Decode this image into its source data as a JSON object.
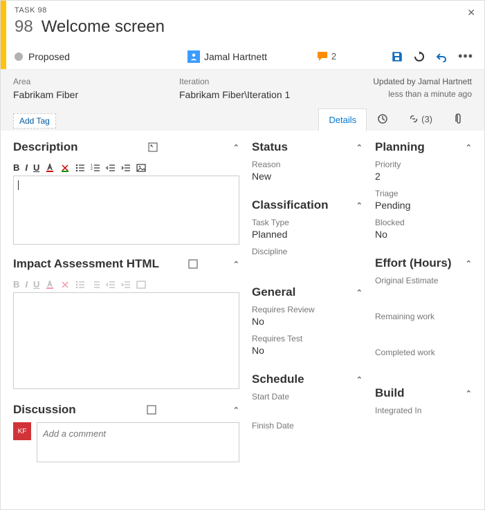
{
  "header": {
    "task_label": "TASK 98",
    "id": "98",
    "title": "Welcome screen",
    "state": "Proposed",
    "assignee": "Jamal Hartnett",
    "comments_count": "2"
  },
  "info": {
    "area_label": "Area",
    "area_value": "Fabrikam Fiber",
    "iteration_label": "Iteration",
    "iteration_value": "Fabrikam Fiber\\Iteration 1",
    "updated_by_prefix": "Updated by ",
    "updated_by_name": "Jamal Hartnett",
    "updated_time": "less than a minute ago",
    "add_tag": "Add Tag"
  },
  "tabs": {
    "details": "Details",
    "links_count": "(3)"
  },
  "sections": {
    "description": "Description",
    "impact": "Impact Assessment HTML",
    "discussion": "Discussion",
    "status": "Status",
    "classification": "Classification",
    "general": "General",
    "schedule": "Schedule",
    "planning": "Planning",
    "effort": "Effort (Hours)",
    "build": "Build"
  },
  "status": {
    "reason_label": "Reason",
    "reason_value": "New"
  },
  "classification": {
    "tasktype_label": "Task Type",
    "tasktype_value": "Planned",
    "discipline_label": "Discipline",
    "discipline_value": ""
  },
  "general": {
    "review_label": "Requires Review",
    "review_value": "No",
    "test_label": "Requires Test",
    "test_value": "No"
  },
  "schedule": {
    "start_label": "Start Date",
    "start_value": "",
    "finish_label": "Finish Date",
    "finish_value": ""
  },
  "planning": {
    "priority_label": "Priority",
    "priority_value": "2",
    "triage_label": "Triage",
    "triage_value": "Pending",
    "blocked_label": "Blocked",
    "blocked_value": "No"
  },
  "effort": {
    "original_label": "Original Estimate",
    "original_value": "",
    "remaining_label": "Remaining work",
    "remaining_value": "",
    "completed_label": "Completed work",
    "completed_value": ""
  },
  "build": {
    "integrated_label": "Integrated In",
    "integrated_value": ""
  },
  "discussion": {
    "avatar_initials": "KF",
    "placeholder": "Add a comment"
  },
  "toolbar": {
    "bold": "B",
    "italic": "I",
    "underline": "U"
  }
}
